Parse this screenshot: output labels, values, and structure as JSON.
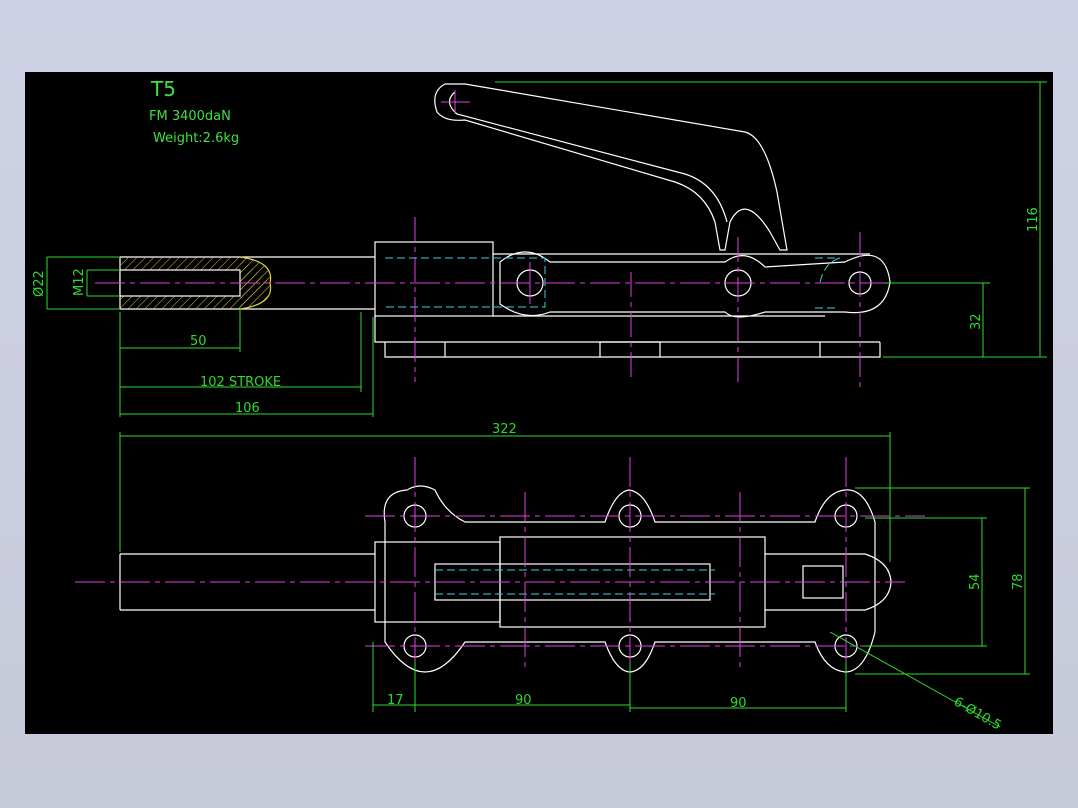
{
  "title": "T5",
  "force": "FM 3400daN",
  "weight": "Weight:2.6kg",
  "dims": {
    "d22": "Ø22",
    "m12": "M12",
    "d50": "50",
    "stroke": "102 STROKE",
    "d106": "106",
    "d322": "322",
    "d116": "116",
    "d32": "32",
    "d54": "54",
    "d78": "78",
    "d17": "17",
    "d90a": "90",
    "d90b": "90",
    "holes": "6-Ø10.5"
  },
  "colors": {
    "background": "#000000",
    "outline": "#ffffff",
    "dimension": "#2bdc2b",
    "centerline": "#e040e0",
    "hidden": "#40d0e0",
    "hatch": "#e0d040"
  }
}
